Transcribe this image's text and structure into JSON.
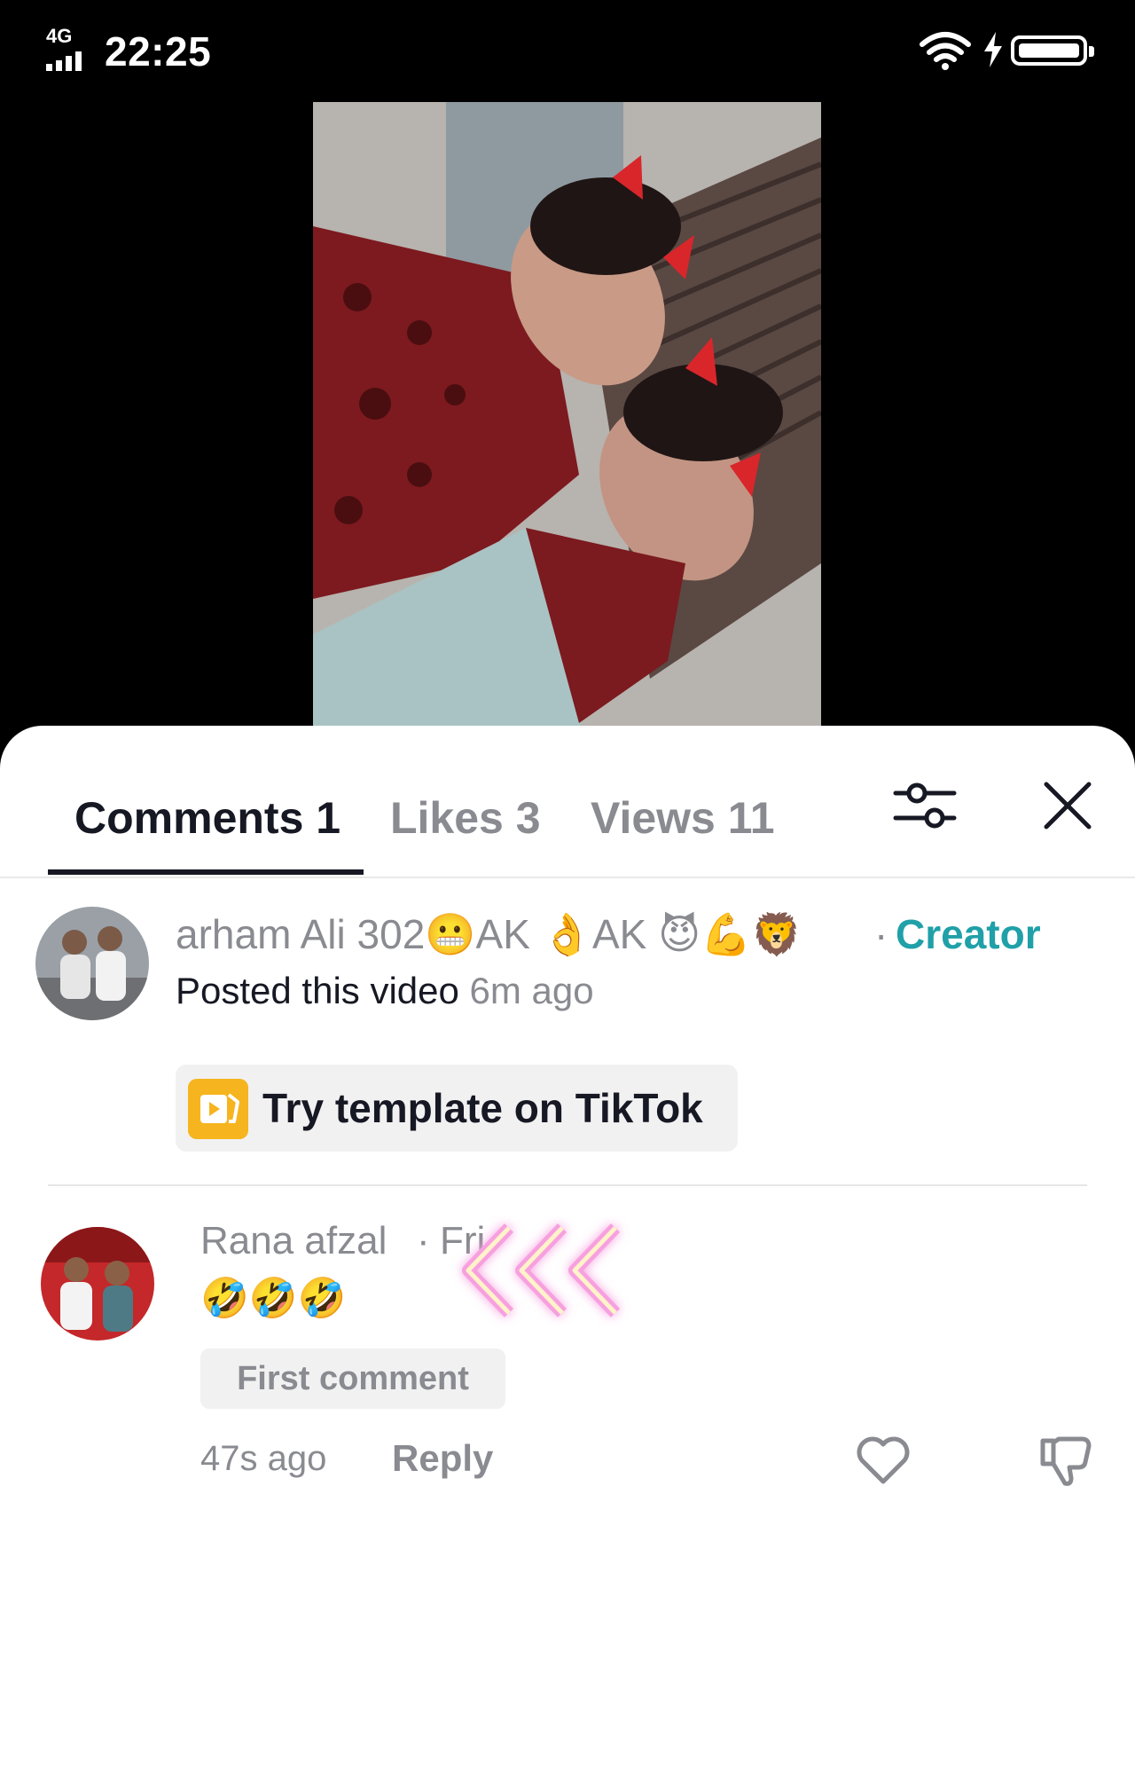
{
  "status_bar": {
    "network": "4G",
    "time": "22:25"
  },
  "tabs": {
    "comments": "Comments 1",
    "likes": "Likes 3",
    "views": "Views 11"
  },
  "creator_post": {
    "author": "arham Ali 302😬AK 👌AK 😈💪🦁",
    "dot": "·",
    "badge": "Creator",
    "posted_text": "Posted this video",
    "time": "6m ago",
    "template_label": "Try template on TikTok"
  },
  "comment": {
    "author": "Rana afzal",
    "dot": "·",
    "relation": "Fri",
    "text": "🤣🤣🤣",
    "badge": "First comment",
    "time": "47s ago",
    "reply_label": "Reply"
  },
  "icons": [
    "filter-icon",
    "close-icon",
    "heart-icon",
    "dislike-icon",
    "template-icon"
  ]
}
